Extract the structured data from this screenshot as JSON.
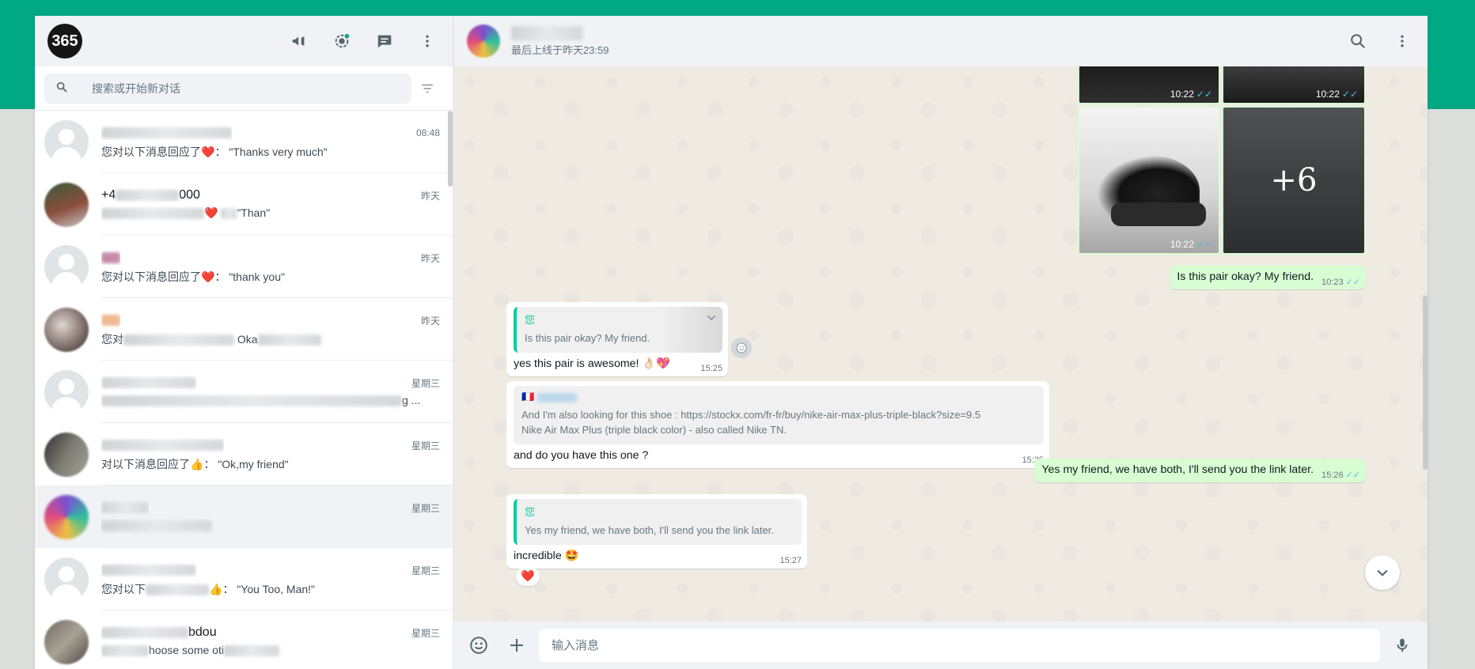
{
  "brand": {
    "logo_text": "365"
  },
  "search": {
    "placeholder": "搜索或开始新对话"
  },
  "chats": [
    {
      "time": "08:48",
      "prefix": "您对以下消息回应了",
      "quote": "：  \"Thanks very much\""
    },
    {
      "name_prefix": "+4",
      "name_suffix": "000",
      "time": "昨天",
      "prefix": "",
      "quote": "\"Than\""
    },
    {
      "time": "昨天",
      "prefix": "您对以下消息回应了",
      "quote": "：  \"thank you\""
    },
    {
      "time": "昨天",
      "prefix": "您对",
      "quote": "Oka"
    },
    {
      "time": "星期三",
      "suffix": "g ..."
    },
    {
      "time": "星期三",
      "prefix": "对以下消息回应了",
      "emoji": "👍",
      "quote": "：  \"Ok,my friend\""
    },
    {
      "time": "星期三"
    },
    {
      "time": "星期三",
      "prefix": "您对以下",
      "quote": "：  \"You Too, Man!\""
    },
    {
      "name_suffix": "bdou",
      "time": "星期三",
      "prefix": "hoose some oti"
    }
  ],
  "header": {
    "status": "最后上线于昨天23:59"
  },
  "photos": {
    "t1": "10:22",
    "t2": "10:22",
    "t3": "10:22",
    "more": "+6"
  },
  "messages": {
    "m1": {
      "text": "Is this pair okay? My friend.",
      "time": "10:23"
    },
    "m2": {
      "quote_author": "您",
      "quote_text": "Is this pair okay? My friend.",
      "text": "yes this pair is awesome! 👌🏻💖",
      "time": "15:25"
    },
    "m3": {
      "quote_text_1": "And I'm also looking for this shoe : https://stockx.com/fr-fr/buy/nike-air-max-plus-triple-black?size=9.5",
      "quote_text_2": "Nike Air Max Plus (triple black color) - also called Nike TN.",
      "text": "and do you have this one ?",
      "time": "15:25"
    },
    "m4": {
      "text": "Yes my friend, we have both, I'll send you the link later.",
      "time": "15:26"
    },
    "m5": {
      "quote_author": "您",
      "quote_text": "Yes my friend, we have both, I'll send you the link later.",
      "text": "incredible 🤩",
      "time": "15:27",
      "reaction": "❤️"
    }
  },
  "composer": {
    "placeholder": "输入消息"
  }
}
